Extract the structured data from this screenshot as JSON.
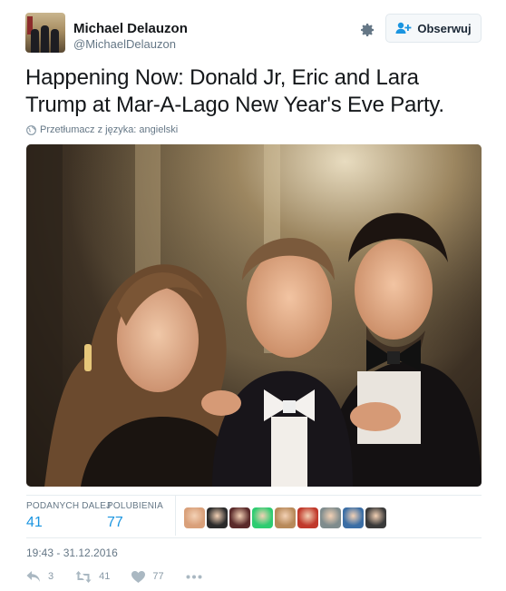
{
  "tweet": {
    "author_name": "Michael Delauzon",
    "author_handle": "@MichaelDelauzon",
    "follow_label": "Obserwuj",
    "text": "Happening Now: Donald Jr, Eric and Lara Trump at Mar-A-Lago New Year's Eve Party.",
    "translate_label": "Przetłumacz z języka: angielski",
    "timestamp": "19:43 - 31.12.2016"
  },
  "stats": {
    "retweets_label": "PODANYCH DALEJ",
    "retweets_value": "41",
    "likes_label": "POLUBIENIA",
    "likes_value": "77"
  },
  "liker_avatars": [
    {
      "color": "#d9a07a"
    },
    {
      "color": "#2b2b2b"
    },
    {
      "color": "#5a2a2a"
    },
    {
      "color": "#2ecc71"
    },
    {
      "color": "#b88a5a"
    },
    {
      "color": "#c0392b"
    },
    {
      "color": "#7f8c8d"
    },
    {
      "color": "#3b6ea5"
    },
    {
      "color": "#3a3a3a"
    }
  ],
  "actions": {
    "reply_count": "3",
    "retweet_count": "41",
    "like_count": "77"
  },
  "icons": {
    "settings": "gear-icon",
    "follow": "add-user-icon",
    "translate": "globe-icon",
    "reply": "reply-icon",
    "retweet": "retweet-icon",
    "like": "heart-icon",
    "more": "more-icon"
  },
  "colors": {
    "link_blue": "#1b95e0",
    "muted": "#657786"
  }
}
